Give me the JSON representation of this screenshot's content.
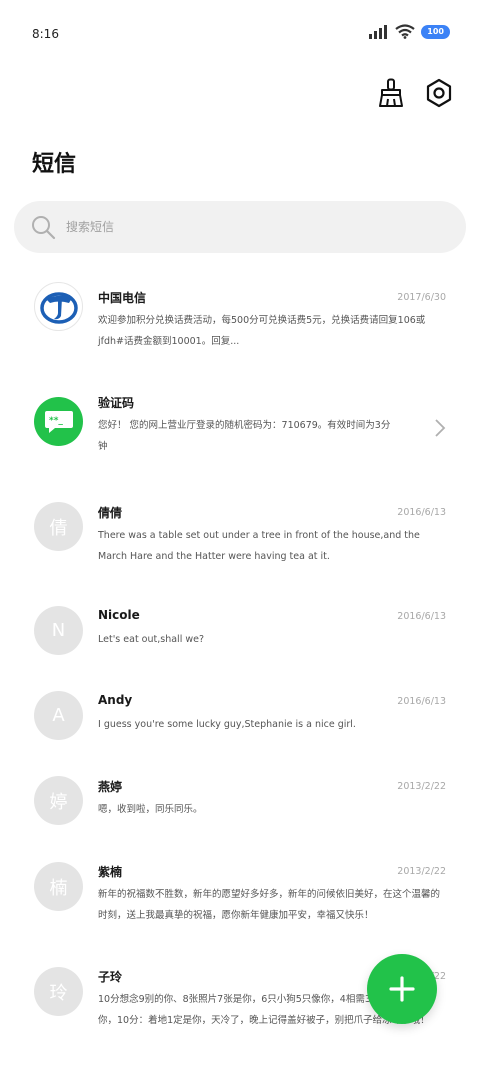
{
  "status_bar": {
    "time": "8:16",
    "battery": "100"
  },
  "page": {
    "title": "短信"
  },
  "search": {
    "placeholder": "搜索短信"
  },
  "colors": {
    "accent_green": "#22c24a",
    "avatar_gray": "#e4e4e4",
    "telecom_blue": "#1c5fb5",
    "battery_blue": "#3b82f6"
  },
  "conversations": [
    {
      "name": "中国电信",
      "date": "2017/6/30",
      "preview": "欢迎参加积分兑换话费活动，每500分可兑换话费5元，兑换话费请回复106或jfdh#话费金额到10001。回复..."
    },
    {
      "name": "验证码",
      "date": "",
      "preview": "您好！ 您的网上营业厅登录的随机密码为：710679。有效时间为3分钟"
    },
    {
      "name": "倩倩",
      "avatar": "倩",
      "date": "2016/6/13",
      "preview": "There was a table set out under a tree in front of the house,and the March Hare and the Hatter were having tea at it."
    },
    {
      "name": "Nicole",
      "avatar": "N",
      "date": "2016/6/13",
      "preview": "Let's eat out,shall we?"
    },
    {
      "name": "Andy",
      "avatar": "A",
      "date": "2016/6/13",
      "preview": "I guess you're some lucky guy,Stephanie is a nice girl."
    },
    {
      "name": "燕婷",
      "avatar": "婷",
      "date": "2013/2/22",
      "preview": "嗯，收到啦，同乐同乐。"
    },
    {
      "name": "紫楠",
      "avatar": "楠",
      "date": "2013/2/22",
      "preview": "新年的祝福数不胜数，新年的愿望好多好多，新年的问候依旧美好，在这个温馨的时刻，送上我最真挚的祝福，愿你新年健康加平安，幸福又快乐！"
    },
    {
      "name": "子玲",
      "avatar": "玲",
      "date": "2013/2/22",
      "preview": "10分想念9别的你、8张照片7张是你，6只小狗5只像你，4相需3有2心，1心想你，10分：着地1定是你，天冷了，晚上记得盖好被子，别把爪子给冻坏了哦！"
    }
  ],
  "icons": {
    "clean": "broom-icon",
    "settings": "settings-hex-icon",
    "search": "search-icon",
    "chevron": "chevron-right-icon",
    "fab": "plus-icon"
  }
}
